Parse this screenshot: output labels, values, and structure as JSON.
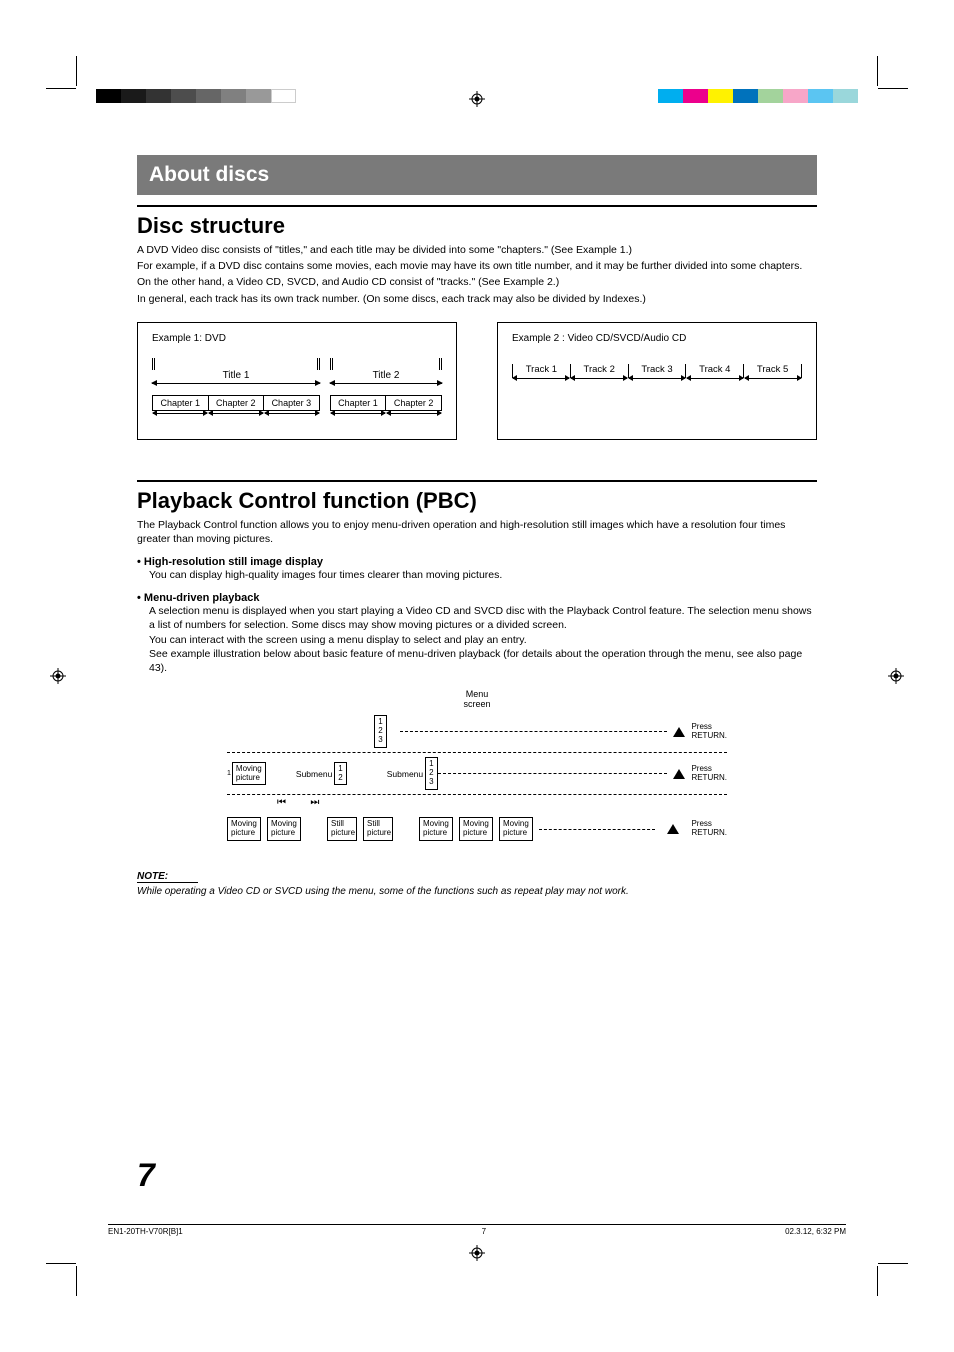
{
  "banner": {
    "title": "About discs"
  },
  "disc_structure": {
    "heading": "Disc structure",
    "p1": "A DVD Video disc consists of \"titles,\" and each title may be divided into some \"chapters.\" (See Example 1.)",
    "p2": "For example, if a DVD disc contains some movies, each movie may have its own title number, and it may be further divided into some chapters.",
    "p3": "On the other hand, a Video CD, SVCD, and Audio CD consist of \"tracks.\" (See Example 2.)",
    "p4": "In general, each track has its own track number. (On some discs, each track may also be divided by Indexes.)",
    "example1": {
      "caption": "Example 1: DVD",
      "title1": "Title 1",
      "title2": "Title 2",
      "chapters_t1": [
        "Chapter 1",
        "Chapter 2",
        "Chapter 3"
      ],
      "chapters_t2": [
        "Chapter 1",
        "Chapter 2"
      ]
    },
    "example2": {
      "caption": "Example 2 : Video CD/SVCD/Audio CD",
      "tracks": [
        "Track 1",
        "Track 2",
        "Track 3",
        "Track 4",
        "Track 5"
      ]
    }
  },
  "pbc": {
    "heading": "Playback Control function (PBC)",
    "p1": "The Playback Control function allows you to enjoy menu-driven operation and high-resolution still images which have a resolution four times greater than moving pictures.",
    "b1_head": "•  High-resolution still image display",
    "b1_body": "You can display high-quality images four times clearer than moving pictures.",
    "b2_head": "•  Menu-driven playback",
    "b2_body1": "A selection menu is displayed when you start playing a Video CD and SVCD disc with the Playback Control feature. The selection menu shows a list of numbers for selection. Some discs may show moving pictures or a divided screen.",
    "b2_body2": "You can interact with the screen using a menu display to select and play an entry.",
    "b2_body3": "See example illustration below about basic feature of menu-driven playback (for details about the operation through the menu, see also page 43).",
    "flow": {
      "menu_screen": "Menu\nscreen",
      "submenu": "Submenu",
      "moving_picture": "Moving\npicture",
      "still_picture": "Still\npicture",
      "press_return": "Press\nRETURN.",
      "nums3": "1\n2\n3",
      "nums2": "1\n2",
      "skip": "◂◂   ▸▸"
    }
  },
  "note": {
    "head": "NOTE:",
    "body": "While operating a Video CD or SVCD using the menu, some of the functions such as repeat play may not work."
  },
  "page_number": "7",
  "footer": {
    "left": "EN1-20TH-V70R[B]1",
    "center": "7",
    "right": "02.3.12, 6:32 PM"
  },
  "colorbars": {
    "left": [
      "#000",
      "#1a1a1a",
      "#333",
      "#4d4d4d",
      "#666",
      "#808080",
      "#999",
      "#fff"
    ],
    "right": [
      "#00aeef",
      "#ec008c",
      "#fff200",
      "#ed1c24",
      "#00a651",
      "#0072bc",
      "#f7941d",
      "#92278f"
    ]
  }
}
